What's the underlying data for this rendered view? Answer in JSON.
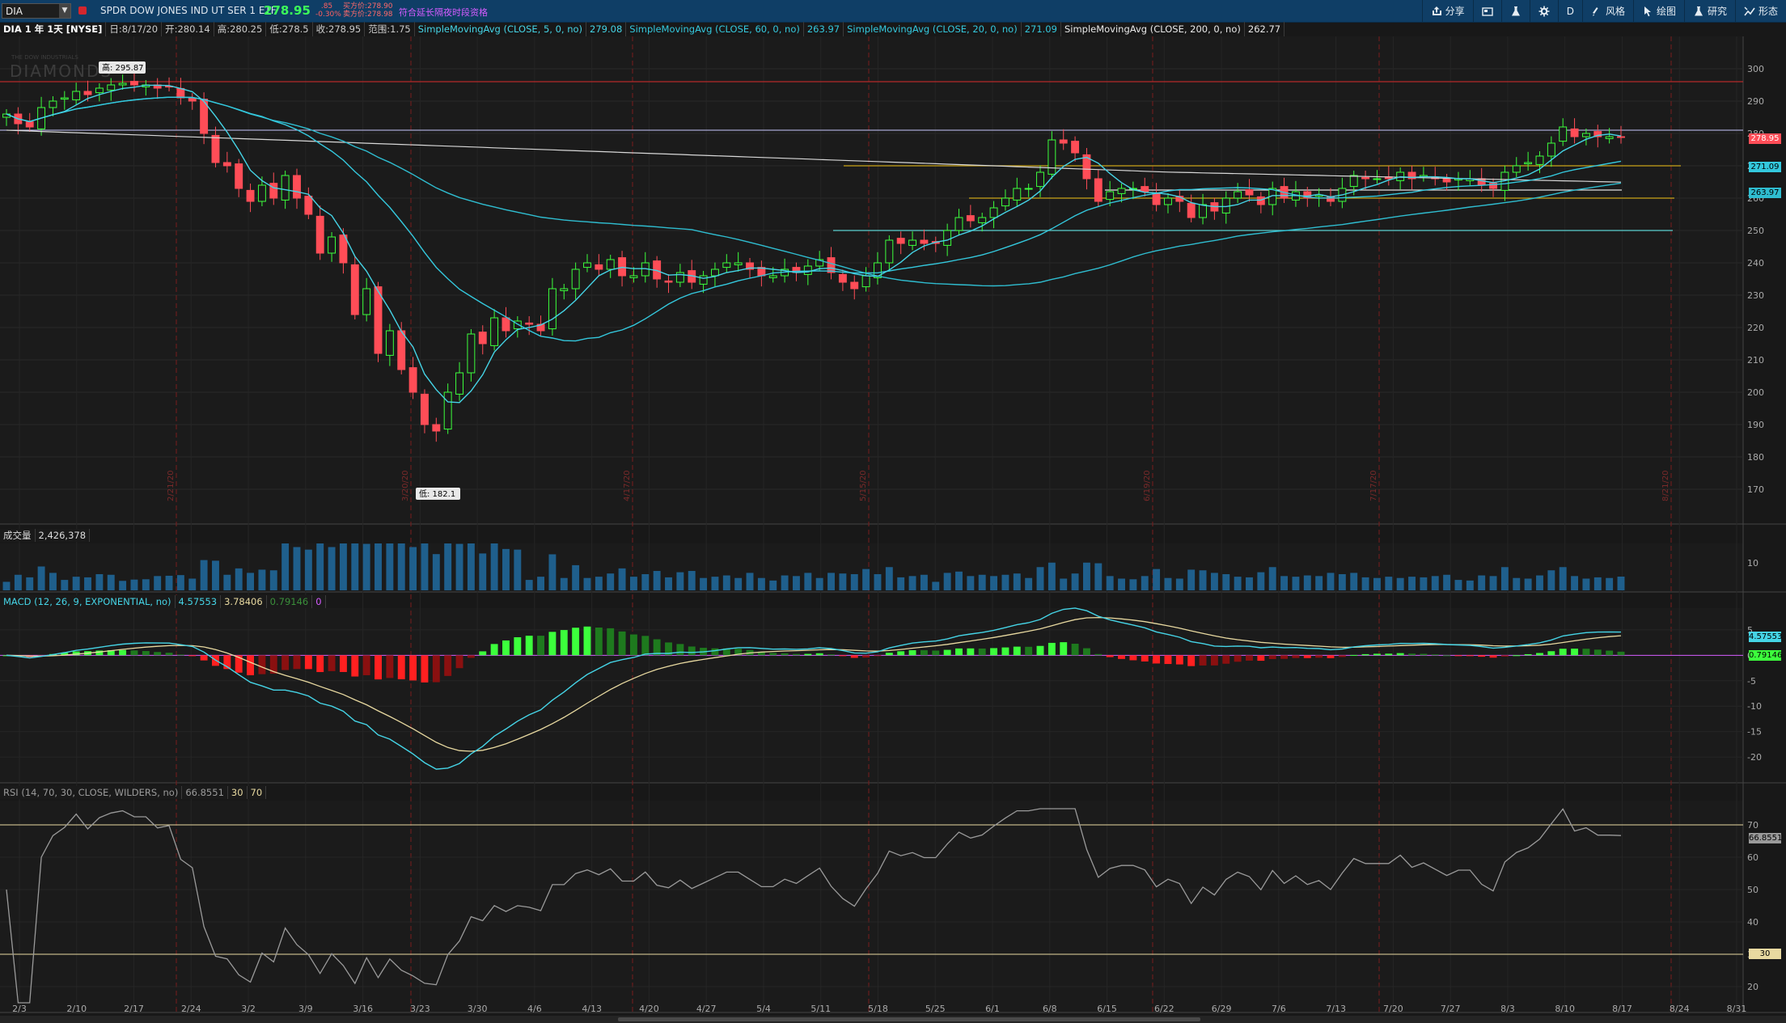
{
  "header": {
    "symbol": "DIA",
    "description": "SPDR DOW JONES IND UT SER 1 ETF",
    "last": "278.95",
    "change": ".85",
    "change_pct": "-0.30%",
    "bid": "买方价:278.90",
    "ask": "卖方价:278.98",
    "extended": "符合延长隔夜时段资格",
    "tools": [
      {
        "label": "分享",
        "icon": "share-icon"
      },
      {
        "label": "",
        "icon": "card-icon"
      },
      {
        "label": "",
        "icon": "flask-icon"
      },
      {
        "label": "",
        "icon": "gear-icon"
      },
      {
        "label": "D",
        "icon": "period"
      },
      {
        "label": "风格",
        "icon": "style-icon"
      },
      {
        "label": "绘图",
        "icon": "cursor-icon"
      },
      {
        "label": "研究",
        "icon": "study-icon"
      },
      {
        "label": "形态",
        "icon": "pattern-icon"
      }
    ]
  },
  "info": {
    "title": "DIA 1 年 1天 [NYSE]",
    "date": "日:8/17/20",
    "open": "开:280.14",
    "high": "高:280.25",
    "low": "低:278.5",
    "close": "收:278.95",
    "range": "范围:1.75",
    "sma5_label": "SimpleMovingAvg (CLOSE, 5, 0, no)",
    "sma5_val": "279.08",
    "sma60_label": "SimpleMovingAvg (CLOSE, 60, 0, no)",
    "sma60_val": "263.97",
    "sma20_label": "SimpleMovingAvg (CLOSE, 20, 0, no)",
    "sma20_val": "271.09",
    "sma200_label": "SimpleMovingAvg (CLOSE, 200, 0, no)",
    "sma200_val": "262.77"
  },
  "watermark": {
    "small": "THE DOW INDUSTRIALS",
    "big": "DIAMONDS"
  },
  "annotations": {
    "high": "高: 295.87",
    "low": "低: 182.1"
  },
  "price_tags": {
    "last": "278.95",
    "sma20": "271.09",
    "sma60": "263.97"
  },
  "price_axis": {
    "ticks": [
      "300",
      "290",
      "280",
      "270",
      "260",
      "250",
      "240",
      "230",
      "220",
      "210",
      "200",
      "190",
      "180",
      "170"
    ]
  },
  "date_axis": [
    "2/3",
    "2/10",
    "2/17",
    "2/24",
    "3/2",
    "3/9",
    "3/16",
    "3/23",
    "3/30",
    "4/6",
    "4/13",
    "4/20",
    "4/27",
    "5/4",
    "5/11",
    "5/18",
    "5/25",
    "6/1",
    "6/8",
    "6/15",
    "6/22",
    "6/29",
    "7/6",
    "7/13",
    "7/20",
    "7/27",
    "8/3",
    "8/10",
    "8/17",
    "8/24",
    "8/31"
  ],
  "month_markers": [
    "2/21/20",
    "3/20/20",
    "4/17/20",
    "5/15/20",
    "6/19/20",
    "7/17/20",
    "8/21/20"
  ],
  "volume": {
    "label": "成交量",
    "value": "2,426,378",
    "tick": "10"
  },
  "macd": {
    "label": "MACD (12, 26, 9, EXPONENTIAL, no)",
    "value": "4.57553",
    "avg": "3.78406",
    "diff": "0.79146",
    "zero": "0",
    "ticks": [
      "5",
      "0",
      "-5",
      "-10",
      "-15",
      "-20"
    ],
    "tag_value": "4.57553",
    "tag_diff": "0.79146"
  },
  "rsi": {
    "label": "RSI (14, 70, 30, CLOSE, WILDERS, no)",
    "value": "66.8551",
    "ob": "30",
    "os": "70",
    "ticks": [
      "70",
      "60",
      "50",
      "40",
      "30",
      "20"
    ],
    "tag_value": "66.8551",
    "tag_os": "30"
  },
  "colors": {
    "up": "#3cff3c",
    "down": "#ff4d57",
    "sma5": "#45d4e6",
    "sma20": "#34c8dd",
    "sma60": "#2fbdd0",
    "sma200": "#d8d8d8",
    "volume": "#1f5f8c",
    "rsi": "#9a9a9a"
  },
  "chart_data": {
    "type": "candlestick",
    "series": [
      {
        "name": "DIA",
        "x": [
          "1/29",
          "1/30",
          "1/31",
          "2/3",
          "2/4",
          "2/5",
          "2/6",
          "2/7",
          "2/10",
          "2/11",
          "2/12",
          "2/13",
          "2/14",
          "2/18",
          "2/19",
          "2/20",
          "2/21",
          "2/24",
          "2/25",
          "2/26",
          "2/27",
          "2/28",
          "3/2",
          "3/3",
          "3/4",
          "3/5",
          "3/6",
          "3/9",
          "3/10",
          "3/11",
          "3/12",
          "3/13",
          "3/16",
          "3/17",
          "3/18",
          "3/19",
          "3/20",
          "3/23",
          "3/24",
          "3/25",
          "3/26",
          "3/27",
          "3/30",
          "3/31",
          "4/1",
          "4/2",
          "4/3",
          "4/6",
          "4/7",
          "4/8",
          "4/9",
          "4/13",
          "4/14",
          "4/15",
          "4/16",
          "4/17",
          "4/20",
          "4/21",
          "4/22",
          "4/23",
          "4/24",
          "4/27",
          "4/28",
          "4/29",
          "4/30",
          "5/1",
          "5/4",
          "5/5",
          "5/6",
          "5/7",
          "5/8",
          "5/11",
          "5/12",
          "5/13",
          "5/14",
          "5/15",
          "5/18",
          "5/19",
          "5/20",
          "5/21",
          "5/22",
          "5/26",
          "5/27",
          "5/28",
          "5/29",
          "6/1",
          "6/2",
          "6/3",
          "6/4",
          "6/5",
          "6/8",
          "6/9",
          "6/10",
          "6/11",
          "6/12",
          "6/15",
          "6/16",
          "6/17",
          "6/18",
          "6/19",
          "6/22",
          "6/23",
          "6/24",
          "6/25",
          "6/26",
          "6/29",
          "6/30",
          "7/1",
          "7/2",
          "7/6",
          "7/7",
          "7/8",
          "7/9",
          "7/10",
          "7/13",
          "7/14",
          "7/15",
          "7/16",
          "7/17",
          "7/20",
          "7/21",
          "7/22",
          "7/23",
          "7/24",
          "7/27",
          "7/28",
          "7/29",
          "7/30",
          "7/31",
          "8/3",
          "8/4",
          "8/5",
          "8/6",
          "8/7",
          "8/10",
          "8/11",
          "8/12",
          "8/13",
          "8/14",
          "8/17"
        ],
        "close": [
          286,
          283,
          282,
          288,
          290,
          291,
          293,
          292,
          294,
          295,
          295.5,
          295,
          295,
          294,
          294.5,
          291,
          290,
          280,
          271,
          270,
          263,
          259,
          264,
          260,
          267,
          260,
          255,
          243,
          248,
          240,
          224,
          232,
          212,
          219,
          207,
          200,
          190,
          188,
          200,
          206,
          218,
          215,
          223,
          219,
          222,
          221,
          219,
          232,
          232,
          238,
          240,
          238,
          241,
          236,
          236,
          240,
          235,
          234,
          237,
          234,
          236,
          238,
          240,
          240,
          238,
          236,
          236,
          238,
          237,
          239,
          241,
          237,
          234,
          232,
          236,
          240,
          247,
          246,
          247,
          246,
          246,
          250,
          254,
          253,
          254,
          257,
          260,
          263,
          263,
          268,
          278,
          277,
          274,
          266,
          259,
          262,
          263,
          263,
          262,
          258,
          260,
          259,
          254,
          258,
          256,
          260,
          262,
          261,
          258,
          263,
          260,
          262,
          260,
          261,
          259,
          263,
          267,
          266,
          266,
          266,
          268,
          266,
          267,
          266,
          265,
          266,
          266,
          264,
          263,
          268,
          270,
          271,
          273,
          277,
          282,
          279,
          280,
          279,
          279,
          278.95
        ]
      }
    ],
    "ylim": [
      170,
      300
    ],
    "studies": [
      "SMA 5",
      "SMA 20",
      "SMA 60",
      "SMA 200",
      "Volume",
      "MACD",
      "RSI"
    ]
  }
}
